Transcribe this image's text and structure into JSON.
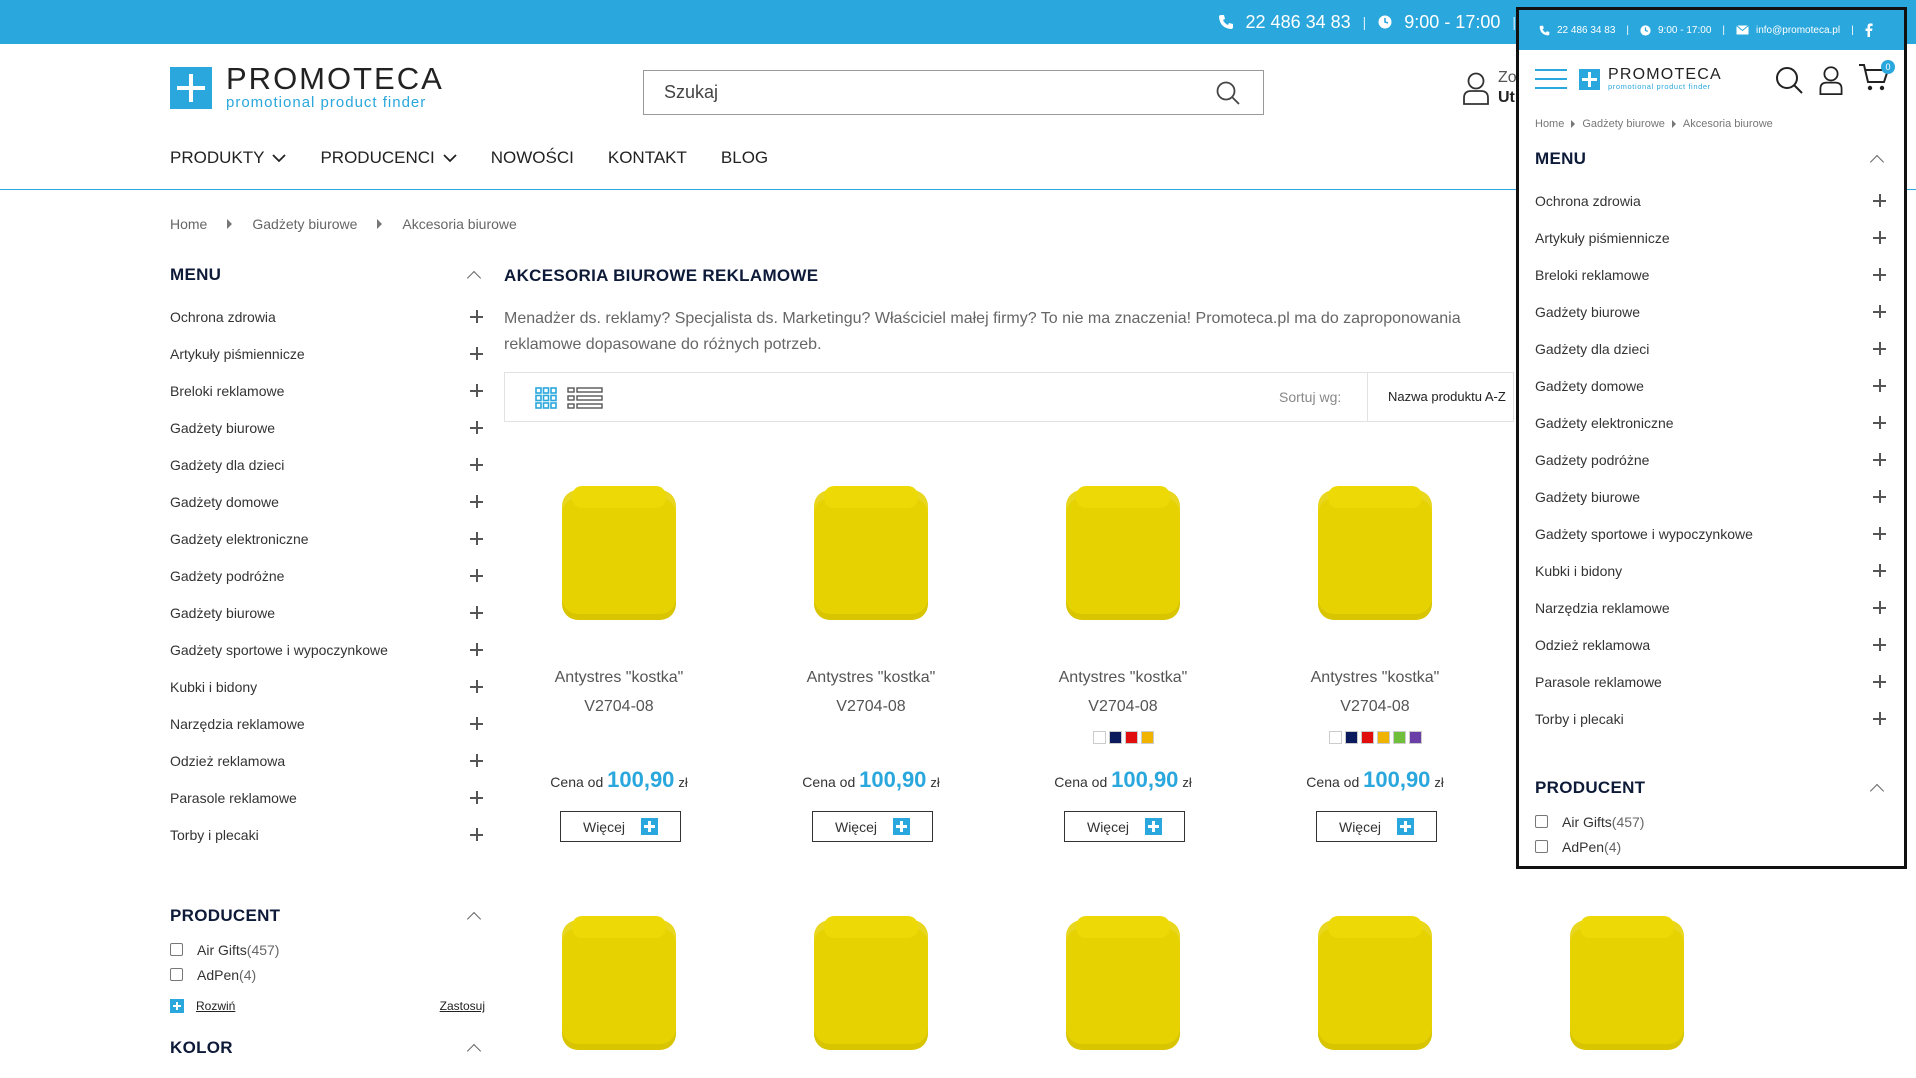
{
  "topbar": {
    "phone": "22 486 34 83",
    "hours": "9:00 - 17:00"
  },
  "brand": {
    "name": "PROMOTECA",
    "tagline": "promotional product finder"
  },
  "search": {
    "placeholder": "Szukaj"
  },
  "account": {
    "line1": "Zo",
    "line2": "Ut"
  },
  "nav": [
    {
      "label": "PRODUKTY",
      "dropdown": true
    },
    {
      "label": "PRODUCENCI",
      "dropdown": true
    },
    {
      "label": "NOWOŚCI",
      "dropdown": false
    },
    {
      "label": "KONTAKT",
      "dropdown": false
    },
    {
      "label": "BLOG",
      "dropdown": false
    }
  ],
  "breadcrumb": [
    "Home",
    "Gadżety biurowe",
    "Akcesoria biurowe"
  ],
  "sidebar": {
    "menu_title": "MENU",
    "items": [
      "Ochrona zdrowia",
      "Artykuły piśmiennicze",
      "Breloki reklamowe",
      "Gadżety biurowe",
      "Gadżety dla dzieci",
      "Gadżety domowe",
      "Gadżety elektroniczne",
      "Gadżety podróżne",
      "Gadżety biurowe",
      "Gadżety sportowe i wypoczynkowe",
      "Kubki i bidony",
      "Narzędzia reklamowe",
      "Odzież reklamowa",
      "Parasole reklamowe",
      "Torby i plecaki"
    ],
    "producent_title": "PRODUCENT",
    "producers": [
      {
        "name": "Air Gifts",
        "count": "(457)"
      },
      {
        "name": "AdPen",
        "count": "(4)"
      }
    ],
    "expand_label": "Rozwiń",
    "apply_label": "Zastosuj",
    "kolor_title": "KOLOR"
  },
  "main": {
    "title": "AKCESORIA BIUROWE REKLAMOWE",
    "description": "Menadżer ds. reklamy? Specjalista ds. Marketingu? Właściciel małej firmy? To nie ma znaczenia! Promoteca.pl ma do zaproponowania",
    "description2": "reklamowe dopasowane do różnych potrzeb.",
    "sort_label": "Sortuj wg:",
    "sort_value": "Nazwa produktu A-Z"
  },
  "products": [
    {
      "name": "Antystres \"kostka\"",
      "code": "V2704-08",
      "price_prefix": "Cena od",
      "price": "100,90",
      "currency": "zł",
      "more": "Więcej",
      "colors": []
    },
    {
      "name": "Antystres \"kostka\"",
      "code": "V2704-08",
      "price_prefix": "Cena od",
      "price": "100,90",
      "currency": "zł",
      "more": "Więcej",
      "colors": []
    },
    {
      "name": "Antystres \"kostka\"",
      "code": "V2704-08",
      "price_prefix": "Cena od",
      "price": "100,90",
      "currency": "zł",
      "more": "Więcej",
      "colors": [
        "#ffffff",
        "#0a1a5c",
        "#e10e0e",
        "#f0b400"
      ]
    },
    {
      "name": "Antystres \"kostka\"",
      "code": "V2704-08",
      "price_prefix": "Cena od",
      "price": "100,90",
      "currency": "zł",
      "more": "Więcej",
      "colors": [
        "#ffffff",
        "#0a1a5c",
        "#e10e0e",
        "#f0b400",
        "#6fbf3a",
        "#6a3fa8"
      ]
    }
  ],
  "mobile": {
    "phone": "22 486 34 83",
    "hours": "9:00 - 17:00",
    "email": "info@promoteca.pl",
    "cart_count": "0"
  },
  "colors": {
    "accent": "#2aa7dc",
    "product": "#e6d200",
    "title": "#0d1a38"
  }
}
